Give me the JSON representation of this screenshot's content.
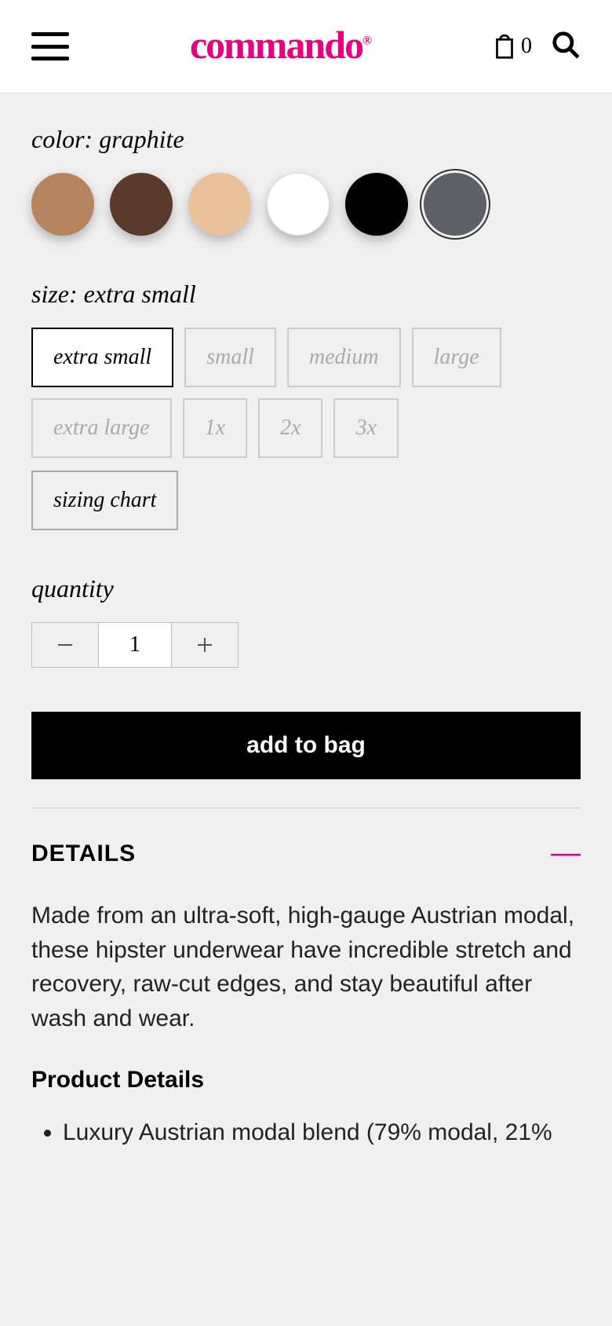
{
  "header": {
    "logo_text": "commando",
    "bag_count": "0"
  },
  "color": {
    "label_prefix": "color: ",
    "selected": "graphite",
    "options": [
      {
        "name": "caramel",
        "hex": "#b6845f"
      },
      {
        "name": "mocha",
        "hex": "#5a3a2a"
      },
      {
        "name": "nude",
        "hex": "#e9c29b"
      },
      {
        "name": "white",
        "hex": "#ffffff"
      },
      {
        "name": "black",
        "hex": "#000000"
      },
      {
        "name": "graphite",
        "hex": "#5d6067"
      }
    ]
  },
  "size": {
    "label_prefix": "size: ",
    "selected": "extra small",
    "options": [
      "extra small",
      "small",
      "medium",
      "large",
      "extra large",
      "1x",
      "2x",
      "3x"
    ],
    "sizing_chart_label": "sizing chart"
  },
  "quantity": {
    "label": "quantity",
    "value": "1"
  },
  "add_to_bag_label": "add to bag",
  "details": {
    "title": "DETAILS",
    "description": "Made from an ultra-soft, high-gauge Austrian modal, these hipster underwear have incredible stretch and recovery, raw-cut edges, and stay beautiful after wash and wear.",
    "subheading": "Product Details",
    "bullets": [
      "Luxury Austrian modal blend (79% modal, 21%"
    ]
  }
}
